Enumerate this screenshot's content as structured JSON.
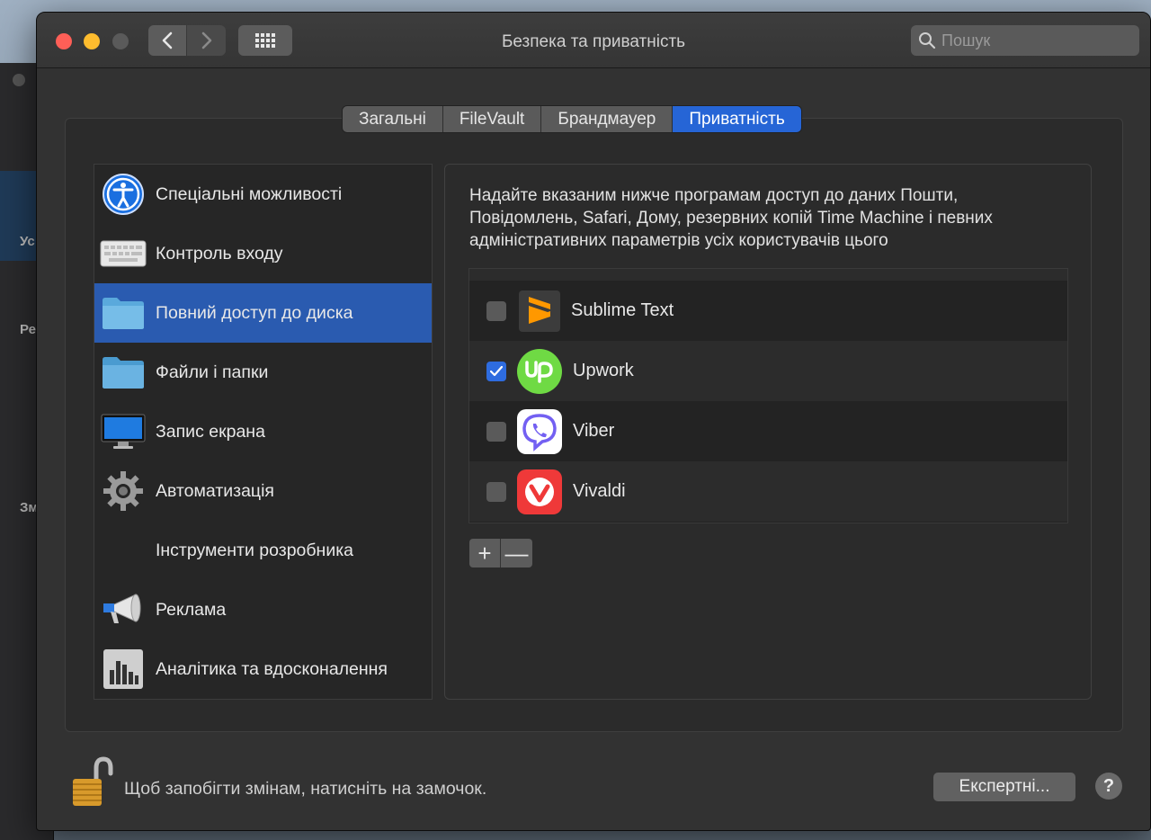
{
  "window": {
    "title": "Безпека та приватність",
    "search_placeholder": "Пошук"
  },
  "background_window": {
    "fragments": [
      "Ус",
      "Ре",
      "Зм"
    ]
  },
  "tabs": [
    {
      "label": "Загальні",
      "active": false
    },
    {
      "label": "FileVault",
      "active": false
    },
    {
      "label": "Брандмауер",
      "active": false
    },
    {
      "label": "Приватність",
      "active": true
    }
  ],
  "categories": [
    {
      "label": "Спеціальні можливості",
      "icon": "accessibility-icon"
    },
    {
      "label": "Контроль входу",
      "icon": "keyboard-icon"
    },
    {
      "label": "Повний доступ до диска",
      "icon": "folder-icon",
      "selected": true
    },
    {
      "label": "Файли і папки",
      "icon": "folder-icon"
    },
    {
      "label": "Запис екрана",
      "icon": "monitor-icon"
    },
    {
      "label": "Автоматизація",
      "icon": "gear-icon"
    },
    {
      "label": "Інструменти розробника",
      "icon": ""
    },
    {
      "label": "Реклама",
      "icon": "megaphone-icon"
    },
    {
      "label": "Аналітика та вдосконалення",
      "icon": "chart-icon"
    }
  ],
  "description": "Надайте вказаним нижче програмам доступ до даних Пошти, Повідомлень, Safari, Дому, резервних копій Time Machine і певних адміністративних параметрів усіх користувачів цього",
  "apps": [
    {
      "name": "Sublime Text",
      "checked": false,
      "icon": "sublime-text-icon"
    },
    {
      "name": "Upwork",
      "checked": true,
      "icon": "upwork-icon"
    },
    {
      "name": "Viber",
      "checked": false,
      "icon": "viber-icon"
    },
    {
      "name": "Vivaldi",
      "checked": false,
      "icon": "vivaldi-icon"
    }
  ],
  "controls": {
    "add_label": "+",
    "remove_label": "—"
  },
  "footer": {
    "lock_text": "Щоб запобігти змінам, натисніть на замочок.",
    "advanced_button": "Експертні...",
    "help_label": "?"
  },
  "colors": {
    "accent": "#2665d6",
    "selection": "#2a5bb0"
  }
}
